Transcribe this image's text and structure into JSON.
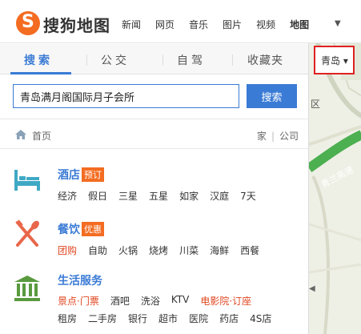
{
  "header": {
    "logo_text": "搜狗地图",
    "nav": [
      {
        "label": "新闻",
        "active": false
      },
      {
        "label": "网页",
        "active": false
      },
      {
        "label": "音乐",
        "active": false
      },
      {
        "label": "图片",
        "active": false
      },
      {
        "label": "视频",
        "active": false
      },
      {
        "label": "地图",
        "active": true
      }
    ],
    "more_icon": "caret-down-icon"
  },
  "tabs": [
    {
      "label": "搜索",
      "active": true
    },
    {
      "label": "公交",
      "active": false
    },
    {
      "label": "自驾",
      "active": false
    },
    {
      "label": "收藏夹",
      "active": false
    }
  ],
  "city": {
    "label": "青岛 ▾"
  },
  "search": {
    "value": "青岛满月阁国际月子会所",
    "button_label": "搜索"
  },
  "breadcrumb": {
    "home_label": "首页",
    "home_link": "家",
    "company_link": "公司"
  },
  "categories": [
    {
      "icon": "hotel-bed-icon",
      "title": "酒店",
      "badge": "预订",
      "items": [
        {
          "label": "经济",
          "hot": false
        },
        {
          "label": "假日",
          "hot": false
        },
        {
          "label": "三星",
          "hot": false
        },
        {
          "label": "五星",
          "hot": false
        },
        {
          "label": "如家",
          "hot": false
        },
        {
          "label": "汉庭",
          "hot": false
        },
        {
          "label": "7天",
          "hot": false
        }
      ]
    },
    {
      "icon": "fork-knife-icon",
      "title": "餐饮",
      "badge": "优惠",
      "items": [
        {
          "label": "团购",
          "hot": true
        },
        {
          "label": "自助",
          "hot": false
        },
        {
          "label": "火锅",
          "hot": false
        },
        {
          "label": "烧烤",
          "hot": false
        },
        {
          "label": "川菜",
          "hot": false
        },
        {
          "label": "海鲜",
          "hot": false
        },
        {
          "label": "西餐",
          "hot": false
        }
      ]
    },
    {
      "icon": "building-icon",
      "title": "生活服务",
      "badge": "",
      "items": [
        {
          "label": "景点·门票",
          "hot": true
        },
        {
          "label": "酒吧",
          "hot": false
        },
        {
          "label": "洗浴",
          "hot": false
        },
        {
          "label": "KTV",
          "hot": false
        },
        {
          "label": "电影院·订座",
          "hot": true
        }
      ],
      "items2": [
        {
          "label": "租房",
          "hot": false
        },
        {
          "label": "二手房",
          "hot": false
        },
        {
          "label": "银行",
          "hot": false
        },
        {
          "label": "超市",
          "hot": false
        },
        {
          "label": "医院",
          "hot": false
        },
        {
          "label": "药店",
          "hot": false
        },
        {
          "label": "4S店",
          "hot": false
        }
      ]
    }
  ],
  "map": {
    "area_label": "区",
    "road_label": "青兰高速",
    "collapse_icon": "caret-left-icon"
  },
  "colors": {
    "accent": "#3a7bd5",
    "brand": "#f36c21",
    "highlight_border": "#e02020",
    "hot_text": "#e0461f"
  }
}
